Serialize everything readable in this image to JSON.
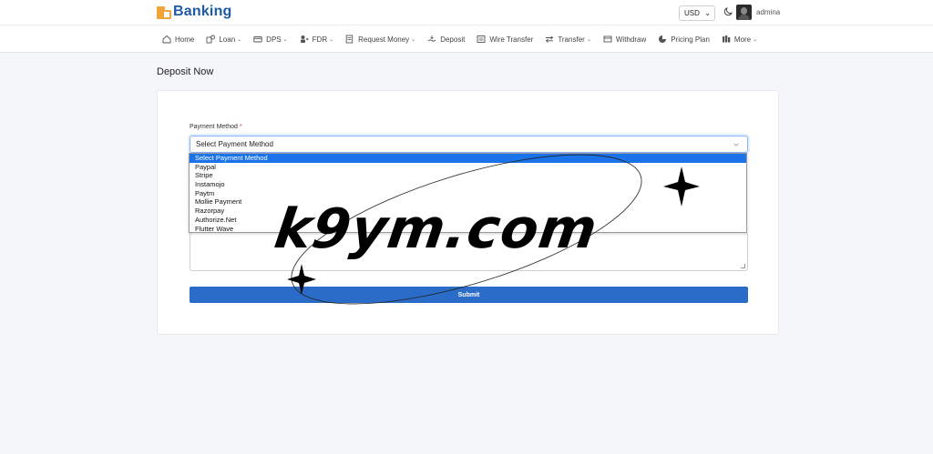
{
  "app": {
    "name": "Banking"
  },
  "header": {
    "currency": "USD",
    "username": "admina"
  },
  "nav": {
    "items": [
      {
        "label": "Home",
        "icon": "home-icon",
        "dropdown": false
      },
      {
        "label": "Loan",
        "icon": "loan-icon",
        "dropdown": true
      },
      {
        "label": "DPS",
        "icon": "dps-icon",
        "dropdown": true
      },
      {
        "label": "FDR",
        "icon": "fdr-icon",
        "dropdown": true
      },
      {
        "label": "Request Money",
        "icon": "request-money-icon",
        "dropdown": true
      },
      {
        "label": "Deposit",
        "icon": "deposit-icon",
        "dropdown": false
      },
      {
        "label": "Wire Transfer",
        "icon": "wire-transfer-icon",
        "dropdown": false
      },
      {
        "label": "Transfer",
        "icon": "transfer-icon",
        "dropdown": true
      },
      {
        "label": "Withdraw",
        "icon": "withdraw-icon",
        "dropdown": false
      },
      {
        "label": "Pricing Plan",
        "icon": "pricing-plan-icon",
        "dropdown": false
      },
      {
        "label": "More",
        "icon": "more-icon",
        "dropdown": true
      }
    ]
  },
  "page": {
    "title": "Deposit Now"
  },
  "form": {
    "payment_method_label": "Payment Method",
    "required_mark": "*",
    "selected_value": "Select Payment Method",
    "options": [
      "Select Payment Method",
      "Paypal",
      "Stripe",
      "Instamojo",
      "Paytm",
      "Mollie Payment",
      "Razorpay",
      "Authorize.Net",
      "Flutter Wave"
    ],
    "submit_label": "Submit"
  },
  "watermark": {
    "text": "k9ym.com"
  },
  "colors": {
    "brand": "#1e5aa8",
    "logo_accent": "#f0a23b",
    "submit": "#2a6cc7",
    "selected_option": "#1a73e8",
    "background": "#f5f6f9"
  }
}
